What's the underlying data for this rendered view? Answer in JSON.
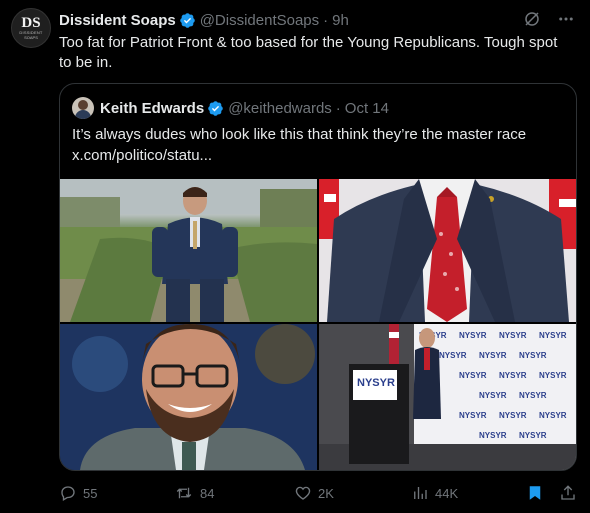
{
  "tweet": {
    "avatar_text": "DS",
    "avatar_subtext": "DISSIDENT",
    "avatar_subtext2": "SOAPS",
    "author_name": "Dissident Soaps",
    "author_handle": "@DissidentSoaps",
    "separator": "·",
    "time": "9h",
    "text": "Too fat for Patriot Front & too based for the Young Republicans. Tough spot to be in."
  },
  "quote": {
    "author_name": "Keith Edwards",
    "author_handle": "@keithedwards",
    "separator": "·",
    "date": "Oct 14",
    "text_line1": "It’s always dudes who look like this that think they’re the master race",
    "text_line2": "x.com/politico/statu..."
  },
  "photos": {
    "sign_text": "NYSYR",
    "backdrop_text": "NYSYR"
  },
  "actions": {
    "replies": "55",
    "reposts": "84",
    "likes": "2K",
    "views": "44K"
  },
  "colors": {
    "background": "#000000",
    "text_primary": "#e7e9ea",
    "text_secondary": "#71767b",
    "verified": "#1d9bf0",
    "border": "#2f3336",
    "bookmark_active": "#1d9bf0"
  },
  "icons": [
    "grok-icon",
    "more-icon",
    "verified-icon",
    "reply-icon",
    "repost-icon",
    "like-icon",
    "views-icon",
    "bookmark-icon",
    "share-icon"
  ]
}
